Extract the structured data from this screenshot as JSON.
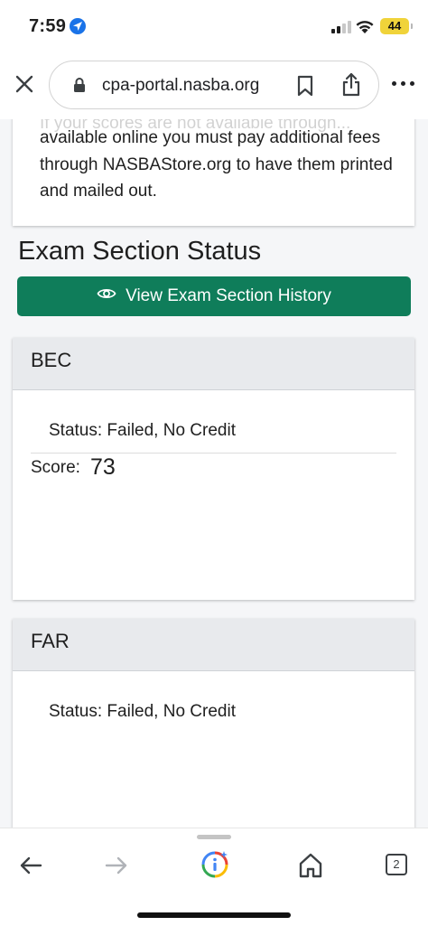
{
  "status_bar": {
    "time": "7:59",
    "battery": "44"
  },
  "browser": {
    "url": "cpa-portal.nasba.org",
    "tab_count": "2"
  },
  "notice": {
    "partial_line": "If your scores are not available through...",
    "text": "available online you must pay additional fees through NASBAStore.org to have them printed and mailed out."
  },
  "exam_section": {
    "heading": "Exam Section Status",
    "history_button": "View Exam Section History"
  },
  "exams": [
    {
      "name": "BEC",
      "status": "Status: Failed, No Credit",
      "score_label": "Score:",
      "score": "73"
    },
    {
      "name": "FAR",
      "status": "Status: Failed, No Credit"
    }
  ],
  "icons": {
    "accent": "#0f7d5a",
    "location": "location-arrow-icon",
    "lock": "lock-icon",
    "bookmark": "bookmark-icon",
    "share": "share-icon",
    "eye": "eye-icon"
  }
}
